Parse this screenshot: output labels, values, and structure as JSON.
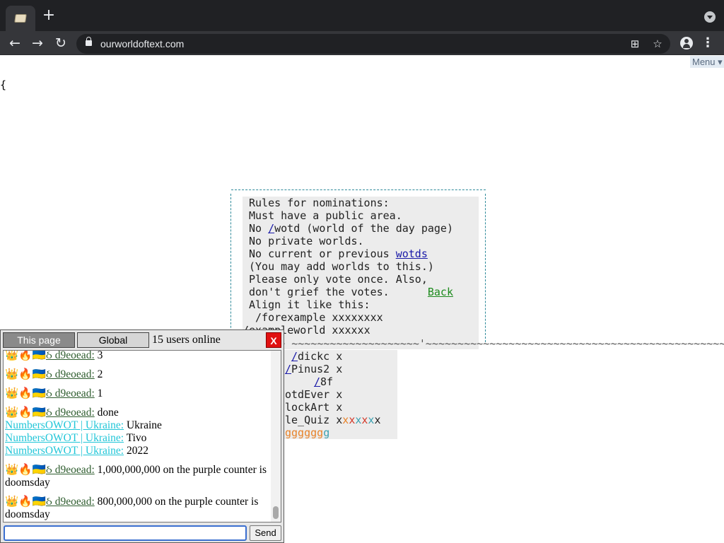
{
  "browser": {
    "url": "ourworldoftext.com",
    "new_tab_glyph": "+",
    "back_glyph": "←",
    "forward_glyph": "→",
    "reload_glyph": "↻",
    "menu_glyph": "⋮",
    "star_glyph": "☆",
    "qr_glyph": "⊞"
  },
  "page": {
    "menu_label": "Menu ▾",
    "brace": "{",
    "rules": {
      "line1": "Rules for nominations:",
      "line2": "Must have a public area.",
      "line3_prefix": "No ",
      "line3_link": "/",
      "line3_suffix": "wotd (world of the day page)",
      "line4": "No private worlds.",
      "line5_prefix": "No current or previous ",
      "line5_link": "wotds",
      "line6": "(You may add worlds to this.)",
      "line7": "Please only vote once. Also,",
      "line8_prefix": "don't grief the votes.      ",
      "line8_link": "Back",
      "line9": "Align it like this:",
      "line10": " /forexample xxxxxxxx",
      "line11": "/exampleworld xxxxxx"
    },
    "tildes": "~~~~~~~ ~~~~~~~~~~~~~~~~~~~~'~~~~~~~~~~~~~~~~~~~~~~~~~~~~~~~~~~~~~~~~~~~~~~~~~~",
    "list": {
      "r1_link": "/",
      "r1_text": "dickc x",
      "r2_link": "/",
      "r2_text": "Pinus2 x",
      "r3_link": "/",
      "r3_text": "8f",
      "r4": "otdEver x",
      "r5": "lockArt x",
      "r6_text": "le_Quiz x",
      "r6_x": [
        "x",
        "x",
        "x",
        "x",
        "x",
        "x"
      ],
      "r7": "gggggg",
      "r7_tail": "g"
    }
  },
  "chat": {
    "tab_this_page": "This page",
    "tab_global": "Global",
    "online": "15 users online",
    "close": "X",
    "send": "Send",
    "input_value": "",
    "nick_prefix_emoji": "👑🔥🇺🇦",
    "messages": [
      {
        "nick": "ઠ d9eoead:",
        "text": " 3"
      },
      {
        "nick": "ઠ d9eoead:",
        "text": " 2"
      },
      {
        "nick": "ઠ d9eoead:",
        "text": " 1"
      },
      {
        "nick": "ઠ d9eoead:",
        "text": " done"
      },
      {
        "nick": "NumbersOWOT | Ukraine:",
        "text": " Ukraine"
      },
      {
        "nick": "NumbersOWOT | Ukraine:",
        "text": " Tivo"
      },
      {
        "nick": "NumbersOWOT | Ukraine:",
        "text": " 2022"
      },
      {
        "nick": "ઠ d9eoead:",
        "text": " 1,000,000,000 on the purple counter is doomsday"
      },
      {
        "nick": "ઠ d9eoead:",
        "text": " 800,000,000 on the purple counter is doomsday"
      }
    ]
  },
  "colors": {
    "chrome_dark": "#202124",
    "chrome_toolbar": "#35363a",
    "dashed_border": "#2e8a9a",
    "link_blue": "#1a1aa8",
    "link_green": "#1c8a1c",
    "nick_cyan": "#22c6d8",
    "close_red": "#e01010"
  }
}
